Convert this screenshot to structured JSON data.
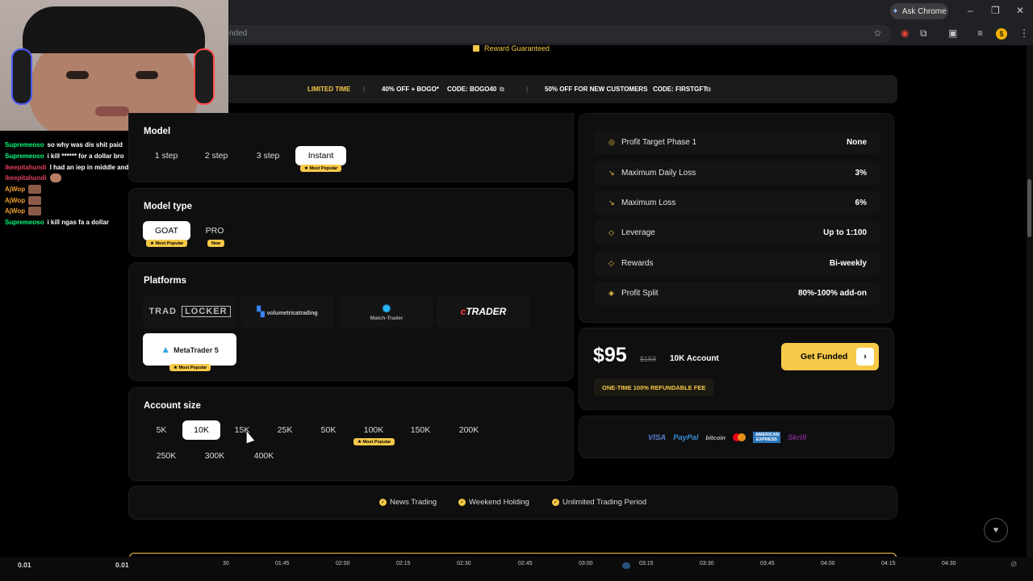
{
  "browser": {
    "ask_chrome": "Ask Chrome",
    "url_fragment": "nded",
    "win_min": "–",
    "win_restore": "❐",
    "win_close": "✕"
  },
  "chat": [
    {
      "user": "Supremeoso",
      "color": "#00ff7f",
      "msg": "so why was dis shit paid"
    },
    {
      "user": "Supremeoso",
      "color": "#00ff7f",
      "msg": "i kill ****** for a dollar bro"
    },
    {
      "user": "ikeepitahundi",
      "color": "#e0405a",
      "msg": "I had an iep in middle and elementary school so Yu gotta work wit me un"
    },
    {
      "user": "ikeepitahundi",
      "color": "#e0405a",
      "msg": "",
      "emote": "round"
    },
    {
      "user": "AjWop",
      "color": "#f0a030",
      "msg": "",
      "emote": "box"
    },
    {
      "user": "AjWop",
      "color": "#f0a030",
      "msg": "",
      "emote": "box"
    },
    {
      "user": "AjWop",
      "color": "#f0a030",
      "msg": "",
      "emote": "box"
    },
    {
      "user": "Supremeoso",
      "color": "#00ff7f",
      "msg": "i kill ngas fa a dollar"
    }
  ],
  "reward_text": "Reward Guaranteed",
  "promo": {
    "limited": "LIMITED TIME",
    "offer1": "40% OFF + BOGO*",
    "code1": "CODE: BOGO40",
    "offer2": "50% OFF FOR NEW CUSTOMERS",
    "code2": "CODE: FIRSTGFT",
    "sep": "|"
  },
  "model": {
    "title": "Model",
    "options": [
      "1 step",
      "2 step",
      "3 step",
      "Instant"
    ],
    "selected": "Instant",
    "badge": "★ Most Popular"
  },
  "model_type": {
    "title": "Model type",
    "options": [
      "GOAT",
      "PRO"
    ],
    "goat_badge": "★ Most Popular",
    "pro_badge": "New"
  },
  "platforms": {
    "title": "Platforms",
    "tradlocker_a": "TRAD",
    "tradlocker_b": "LOCKER",
    "volumetrica": "volumetricatrading",
    "matchtrader": "Match-Trader",
    "ctrader": "TRADER",
    "metatrader": "MetaTrader 5",
    "mt_badge": "★ Most Popular"
  },
  "account_size": {
    "title": "Account size",
    "options": [
      "5K",
      "10K",
      "15K",
      "25K",
      "50K",
      "100K",
      "150K",
      "200K",
      "250K",
      "300K",
      "400K"
    ],
    "selected": "10K",
    "badge": "★ Most Popular"
  },
  "specs": [
    {
      "icon": "target-icon",
      "glyph": "◎",
      "label": "Profit Target Phase 1",
      "value": "None"
    },
    {
      "icon": "trend-down-icon",
      "glyph": "↘",
      "label": "Maximum Daily Loss",
      "value": "3%"
    },
    {
      "icon": "trend-down-icon",
      "glyph": "↘",
      "label": "Maximum Loss",
      "value": "6%"
    },
    {
      "icon": "diamond-icon",
      "glyph": "◇",
      "label": "Leverage",
      "value": "Up to 1:100"
    },
    {
      "icon": "diamond-icon",
      "glyph": "◇",
      "label": "Rewards",
      "value": "Bi-weekly"
    },
    {
      "icon": "tag-icon",
      "glyph": "◈",
      "label": "Profit Split",
      "value": "80%-100% add-on"
    }
  ],
  "pricing": {
    "price": "$95",
    "old_price": "$158",
    "account": "10K Account",
    "cta": "Get Funded",
    "fee_note": "ONE-TIME 100% REFUNDABLE FEE"
  },
  "payments": [
    "VISA",
    "PayPal",
    "bitcoin",
    "mastercard",
    "AMERICAN EXPRESS",
    "Skrill"
  ],
  "features": [
    "News Trading",
    "Weekend Holding",
    "Unlimited Trading Period"
  ],
  "timeline": {
    "left_val1": "0.01",
    "left_val2": "0.01",
    "ticks": [
      "30",
      "01:45",
      "02:00",
      "02:15",
      "02:30",
      "02:45",
      "03:00",
      "03:15",
      "03:30",
      "03:45",
      "04:00",
      "04:15",
      "04:30"
    ]
  },
  "colors": {
    "accent": "#f7c948",
    "panel": "#0f0f0f",
    "bg": "#000000"
  }
}
